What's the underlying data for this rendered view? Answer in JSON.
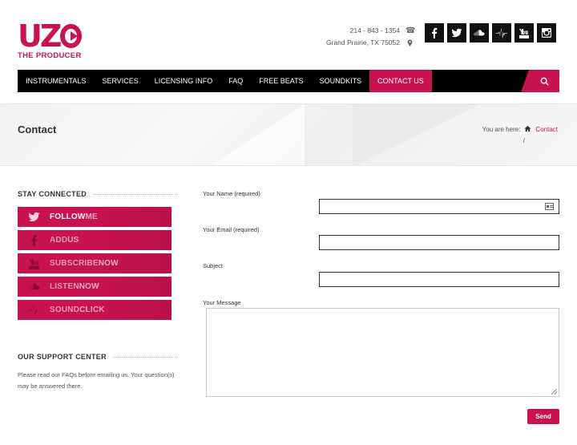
{
  "brand": {
    "logo_text": "UZ",
    "tagline": "THE PRODUCER"
  },
  "contact": {
    "phone": "214 - 843 - 1354",
    "address": "Grand Prairie, TX 75052"
  },
  "socials": [
    "facebook-icon",
    "twitter-icon",
    "soundcloud-icon",
    "soundclick-icon",
    "youtube-icon",
    "instagram-icon"
  ],
  "nav": {
    "items": [
      "INSTRUMENTALS",
      "SERVICES",
      "LICENSING INFO",
      "FAQ",
      "FREE BEATS",
      "SOUNDKITS",
      "CONTACT US"
    ],
    "active": "CONTACT US"
  },
  "page": {
    "title": "Contact",
    "breadcrumb_prefix": "You are here:",
    "breadcrumb_current": "Contact",
    "breadcrumb_separator": "/"
  },
  "sidebar": {
    "stay_connected_title": "STAY CONNECTED",
    "buttons": [
      {
        "bold": "FOLLOW",
        "light": "ME",
        "icon": "twitter-icon"
      },
      {
        "bold": "ADD",
        "light": "US",
        "icon": "facebook-icon"
      },
      {
        "bold": "SUBSCRIBE",
        "light": "NOW",
        "icon": "youtube-icon"
      },
      {
        "bold": "LISTEN",
        "light": "NOW",
        "icon": "soundcloud-icon"
      },
      {
        "bold": "SOUND",
        "light": "CLICK",
        "icon": "soundclick-icon"
      }
    ],
    "support_title": "OUR SUPPORT CENTER",
    "support_text": "Please read our FAQs before emailing us. Your question(s) may be answered there."
  },
  "form": {
    "name_label": "Your Name (required)",
    "email_label": "Your Email (required)",
    "subject_label": "Subject",
    "message_label": "Your Message",
    "send_label": "Send"
  },
  "colors": {
    "accent": "#c8134f",
    "nav_bg": "#000000"
  }
}
